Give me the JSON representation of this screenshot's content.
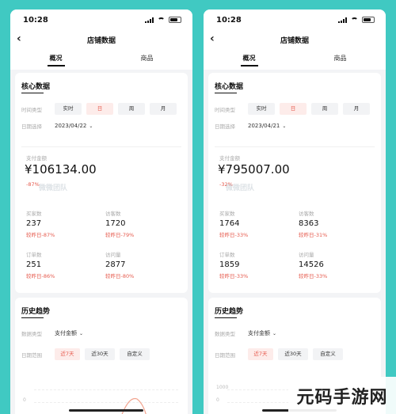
{
  "phones": [
    {
      "status_time": "10:28",
      "header_title": "店铺数据",
      "back_glyph": "‹",
      "tabs": [
        "概况",
        "商品"
      ],
      "core": {
        "title": "核心数据",
        "time_type_label": "时间类型",
        "time_buttons": [
          "实时",
          "日",
          "周",
          "月"
        ],
        "date_label": "日期选择",
        "date_value": "2023/04/22",
        "pay_label": "支付金额",
        "pay_amount": "¥106134.00",
        "pay_change": "-87%",
        "watermark": "微微团队",
        "metrics": [
          {
            "label": "买家数",
            "value": "237",
            "change": "较昨日-87%"
          },
          {
            "label": "访客数",
            "value": "1720",
            "change": "较昨日-79%"
          },
          {
            "label": "订单数",
            "value": "251",
            "change": "较昨日-86%"
          },
          {
            "label": "访问量",
            "value": "2877",
            "change": "较昨日-80%"
          }
        ]
      },
      "history": {
        "title": "历史趋势",
        "data_type_label": "数据类型",
        "data_type_value": "支付金额",
        "range_label": "日期范围",
        "range_buttons": [
          "近7天",
          "近30天",
          "自定义"
        ],
        "y_labels": [
          "",
          "0"
        ]
      }
    },
    {
      "status_time": "10:28",
      "header_title": "店铺数据",
      "back_glyph": "‹",
      "tabs": [
        "概况",
        "商品"
      ],
      "core": {
        "title": "核心数据",
        "time_type_label": "时间类型",
        "time_buttons": [
          "实时",
          "日",
          "周",
          "月"
        ],
        "date_label": "日期选择",
        "date_value": "2023/04/21",
        "pay_label": "支付金额",
        "pay_amount": "¥795007.00",
        "pay_change": "-32%",
        "watermark": "微微团队",
        "metrics": [
          {
            "label": "买家数",
            "value": "1764",
            "change": "较昨日-33%"
          },
          {
            "label": "访客数",
            "value": "8363",
            "change": "较昨日-31%"
          },
          {
            "label": "订单数",
            "value": "1859",
            "change": "较昨日-33%"
          },
          {
            "label": "访问量",
            "value": "14526",
            "change": "较昨日-33%"
          }
        ]
      },
      "history": {
        "title": "历史趋势",
        "data_type_label": "数据类型",
        "data_type_value": "支付金额",
        "range_label": "日期范围",
        "range_buttons": [
          "近7天",
          "近30天",
          "自定义"
        ],
        "y_labels": [
          "1000",
          "0"
        ]
      }
    }
  ],
  "logo_text": "元码手游网",
  "colors": {
    "accent": "#e65a4d",
    "background": "#40c9c2"
  }
}
